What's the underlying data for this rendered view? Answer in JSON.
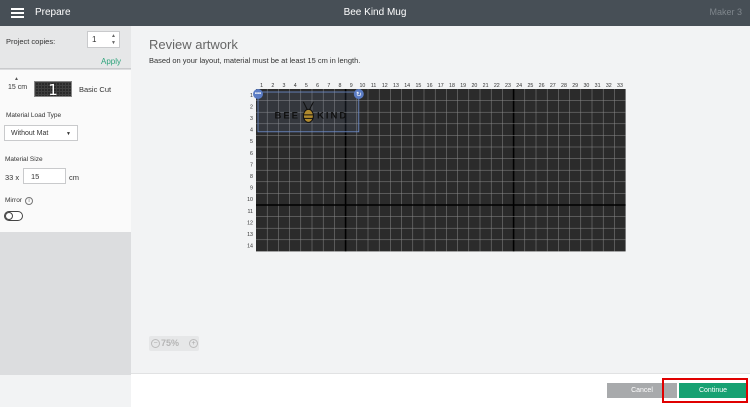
{
  "header": {
    "menu_icon": "hamburger-icon",
    "prepare_label": "Prepare",
    "title": "Bee Kind Mug",
    "machine_label": "Maker 3"
  },
  "left": {
    "copies_label": "Project copies:",
    "copies_value": "1",
    "apply_label": "Apply",
    "mat_length": "15 cm",
    "mat_number": "1",
    "cut_label": "Basic Cut",
    "material_load_label": "Material Load Type",
    "material_load_value": "Without Mat",
    "material_size_label": "Material Size",
    "material_size_prefix": "33 x",
    "material_size_value": "15",
    "material_size_unit": "cm",
    "mirror_label": "Mirror",
    "mirror_on": false,
    "colors": {
      "accent": "#2ea37b"
    }
  },
  "main": {
    "title": "Review artwork",
    "subtitle": "Based on your layout, material must be at least 15 cm in length.",
    "mat": {
      "columns": 33,
      "rows": 14,
      "col_labels": [
        "1",
        "2",
        "3",
        "4",
        "5",
        "6",
        "7",
        "8",
        "9",
        "10",
        "11",
        "12",
        "13",
        "14",
        "15",
        "16",
        "17",
        "18",
        "19",
        "20",
        "21",
        "22",
        "23",
        "24",
        "25",
        "26",
        "27",
        "28",
        "29",
        "30",
        "31",
        "32",
        "33"
      ],
      "row_labels": [
        "1",
        "2",
        "3",
        "4",
        "5",
        "6",
        "7",
        "8",
        "9",
        "10",
        "11",
        "12",
        "13",
        "14"
      ],
      "major_col_lines": [
        8,
        23
      ],
      "major_row_line": 10,
      "artwork_text": "BEE KIND",
      "artwork_left_text": "BEE",
      "artwork_right_text": "KIND",
      "artwork_icon": "bee-icon",
      "artwork_span": {
        "col_start": 1,
        "col_end": 9,
        "row_start": 1,
        "row_end": 4
      }
    },
    "zoom": {
      "value": "75%",
      "minus": "−",
      "plus": "+"
    }
  },
  "footer": {
    "cancel_label": "Cancel",
    "continue_label": "Continue",
    "colors": {
      "continue": "#17a172",
      "highlight": "#e00000"
    }
  }
}
